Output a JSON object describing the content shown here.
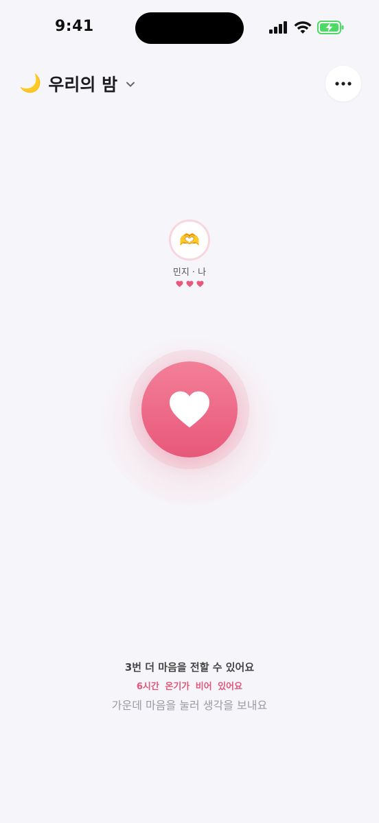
{
  "status_bar": {
    "time": "9:41",
    "icons": [
      "signal-icon",
      "wifi-icon",
      "battery-charging-icon"
    ]
  },
  "header": {
    "emoji": "🌙",
    "title": "우리의 밤",
    "chevron": "chevron-down-icon",
    "more": "more-icon"
  },
  "partner": {
    "emoji": "🫶",
    "name": "민지 · 나",
    "hearts": 3
  },
  "main": {
    "heart": "heart-icon"
  },
  "info": {
    "count_text": "3번 더 마음을 전할 수 있어요",
    "warmth_text": "6시간 온기가 비어 있어요",
    "hint_text": "가운데 마음을 눌러 생각을 보내요"
  },
  "colors": {
    "accent": "#e8587a",
    "accent_light": "#f37f98",
    "background": "#f6f6fa",
    "battery": "#4cd964"
  }
}
